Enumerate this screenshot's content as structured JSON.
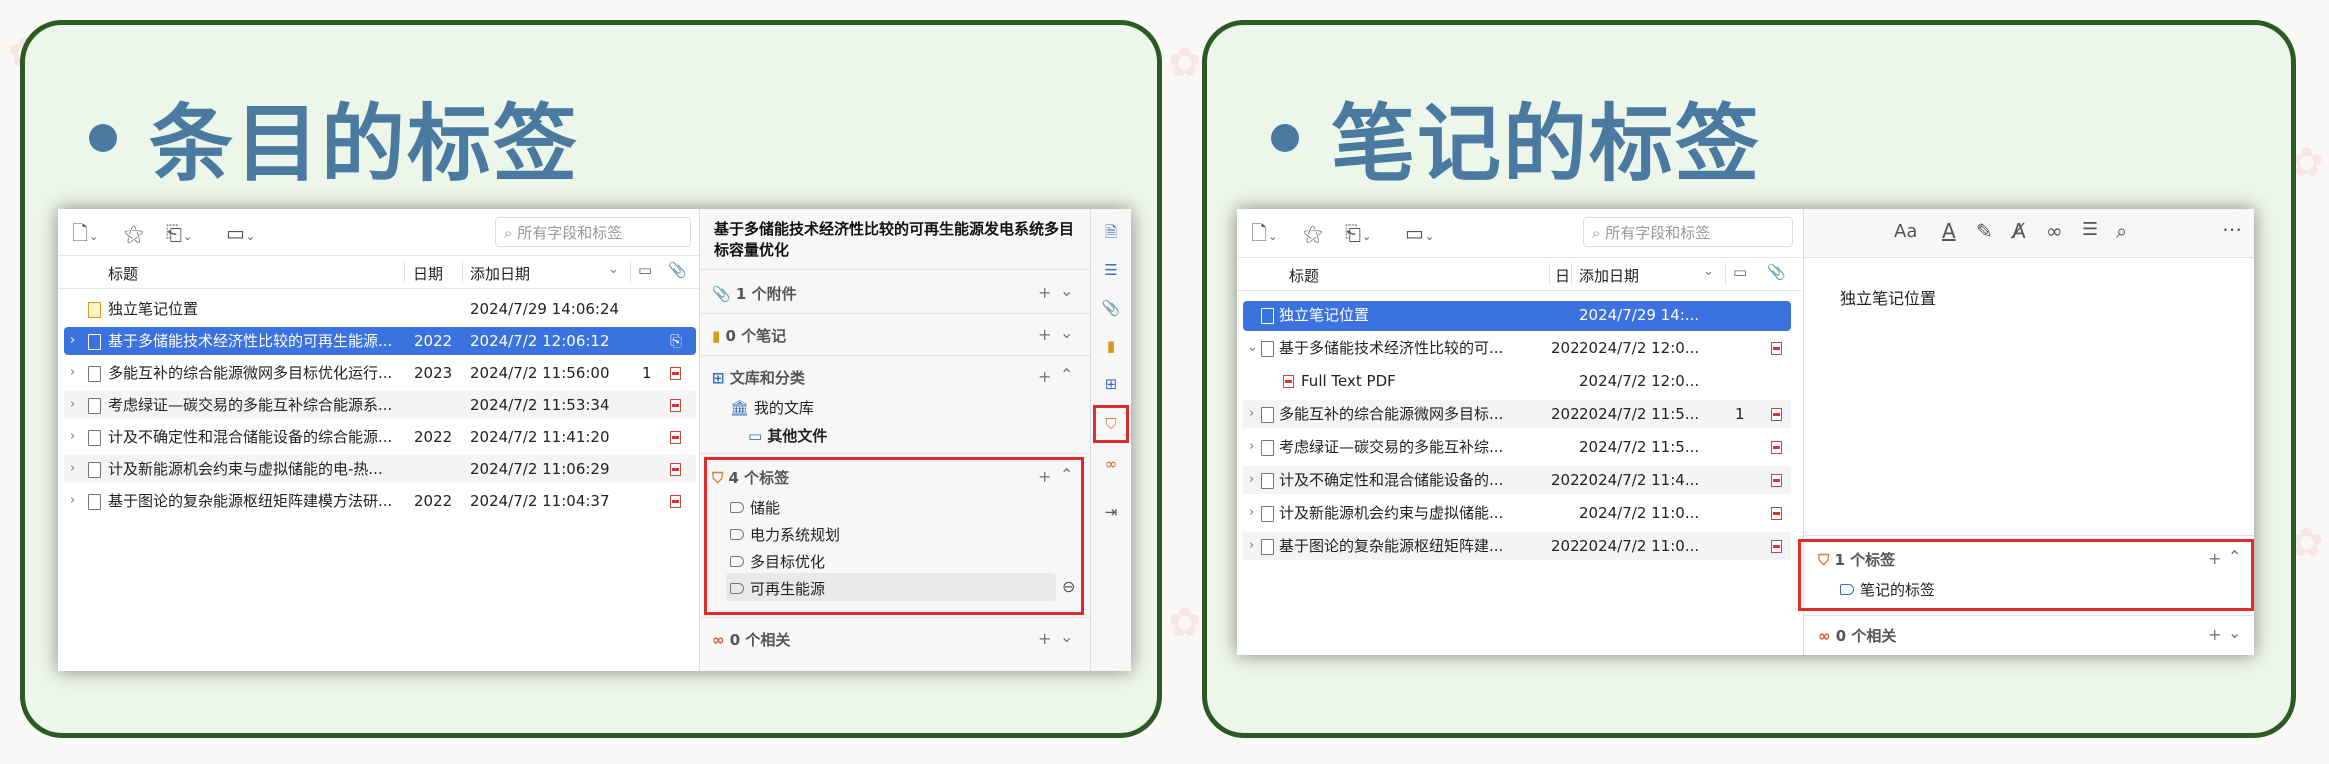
{
  "left": {
    "heading": "条目的标签",
    "search_placeholder": "所有字段和标签",
    "columns": {
      "title": "标题",
      "date": "日期",
      "added": "添加日期"
    },
    "rows": [
      {
        "title": "独立笔记位置",
        "date": "",
        "added": "2024/7/29 14:06:24",
        "count": "",
        "kind": "note"
      },
      {
        "title": "基于多储能技术经济性比较的可再生能源...",
        "date": "2022",
        "added": "2024/7/2 12:06:12",
        "count": "",
        "kind": "doc-selected"
      },
      {
        "title": "多能互补的综合能源微网多目标优化运行...",
        "date": "2023",
        "added": "2024/7/2 11:56:00",
        "count": "1",
        "kind": "doc"
      },
      {
        "title": "考虑绿证—碳交易的多能互补综合能源系...",
        "date": "",
        "added": "2024/7/2 11:53:34",
        "count": "",
        "kind": "doc"
      },
      {
        "title": "计及不确定性和混合储能设备的综合能源...",
        "date": "2022",
        "added": "2024/7/2 11:41:20",
        "count": "",
        "kind": "doc"
      },
      {
        "title": "计及新能源机会约束与虚拟储能的电-热...",
        "date": "",
        "added": "2024/7/2 11:06:29",
        "count": "",
        "kind": "doc"
      },
      {
        "title": "基于图论的复杂能源枢纽矩阵建模方法研...",
        "date": "2022",
        "added": "2024/7/2 11:04:37",
        "count": "",
        "kind": "doc"
      }
    ],
    "item_title": "基于多储能技术经济性比较的可再生能源发电系统多目标容量优化",
    "attachments": "1 个附件",
    "notes": "0 个笔记",
    "libraries": "文库和分类",
    "my_library": "我的文库",
    "collection": "其他文件",
    "tags_header": "4 个标签",
    "tags": [
      "储能",
      "电力系统规划",
      "多目标优化",
      "可再生能源"
    ],
    "related": "0 个相关"
  },
  "right": {
    "heading": "笔记的标签",
    "search_placeholder": "所有字段和标签",
    "columns": {
      "title": "标题",
      "date": "日",
      "added": "添加日期"
    },
    "rows": [
      {
        "title": "独立笔记位置",
        "date": "",
        "added": "2024/7/29 14:...",
        "count": "",
        "kind": "note-selected"
      },
      {
        "title": "基于多储能技术经济性比较的可...",
        "date": "202",
        "added": "2024/7/2 12:0...",
        "count": "",
        "kind": "doc-open"
      },
      {
        "title": "Full Text PDF",
        "date": "",
        "added": "2024/7/2 12:0...",
        "count": "",
        "kind": "pdf-child"
      },
      {
        "title": "多能互补的综合能源微网多目标...",
        "date": "202",
        "added": "2024/7/2 11:5...",
        "count": "1",
        "kind": "doc"
      },
      {
        "title": "考虑绿证—碳交易的多能互补综...",
        "date": "",
        "added": "2024/7/2 11:5...",
        "count": "",
        "kind": "doc"
      },
      {
        "title": "计及不确定性和混合储能设备的...",
        "date": "202",
        "added": "2024/7/2 11:4...",
        "count": "",
        "kind": "doc"
      },
      {
        "title": "计及新能源机会约束与虚拟储能...",
        "date": "",
        "added": "2024/7/2 11:0...",
        "count": "",
        "kind": "doc"
      },
      {
        "title": "基于图论的复杂能源枢纽矩阵建...",
        "date": "202",
        "added": "2024/7/2 11:0...",
        "count": "",
        "kind": "doc"
      }
    ],
    "note_text": "独立笔记位置",
    "tags_header": "1 个标签",
    "tags": [
      "笔记的标签"
    ],
    "related": "0 个相关"
  },
  "colors": {
    "panel_border": "#2c5a25",
    "panel_bg": "#edf6ea",
    "heading": "#4a7aa0",
    "selection": "#3c72e0",
    "highlight": "#e32a2a"
  }
}
